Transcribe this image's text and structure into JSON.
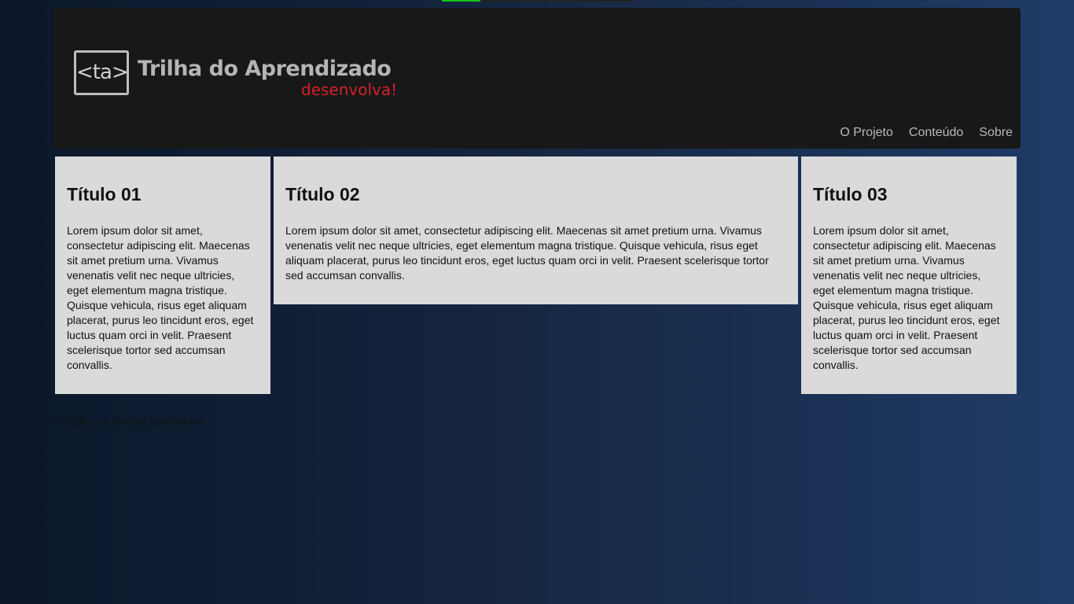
{
  "header": {
    "logo": {
      "mark": "<ta>",
      "title": "Trilha do Aprendizado",
      "tagline": "desenvolva!"
    },
    "nav": [
      {
        "label": "O Projeto"
      },
      {
        "label": "Conteúdo"
      },
      {
        "label": "Sobre"
      }
    ]
  },
  "cards": [
    {
      "title": "Título 01",
      "text": "Lorem ipsum dolor sit amet, consectetur adipiscing elit. Maecenas sit amet pretium urna. Vivamus venenatis velit nec neque ultricies, eget elementum magna tristique. Quisque vehicula, risus eget aliquam placerat, purus leo tincidunt eros, eget luctus quam orci in velit. Praesent scelerisque tortor sed accumsan convallis."
    },
    {
      "title": "Título 02",
      "text": "Lorem ipsum dolor sit amet, consectetur adipiscing elit. Maecenas sit amet pretium urna. Vivamus venenatis velit nec neque ultricies, eget elementum magna tristique. Quisque vehicula, risus eget aliquam placerat, purus leo tincidunt eros, eget luctus quam orci in velit. Praesent scelerisque tortor sed accumsan convallis."
    },
    {
      "title": "Título 03",
      "text": "Lorem ipsum dolor sit amet, consectetur adipiscing elit. Maecenas sit amet pretium urna. Vivamus venenatis velit nec neque ultricies, eget elementum magna tristique. Quisque vehicula, risus eget aliquam placerat, purus leo tincidunt eros, eget luctus quam orci in velit. Praesent scelerisque tortor sed accumsan convallis."
    }
  ],
  "footer": {
    "text": "© Todos os direitos reservados"
  },
  "colors": {
    "header_bg": "#181818",
    "card_bg": "#dadada",
    "logo_title": "#b5b5b5",
    "logo_tagline": "#d1212b",
    "nav_text": "#b9b9b9",
    "top_strip_accent": "#15c521"
  }
}
